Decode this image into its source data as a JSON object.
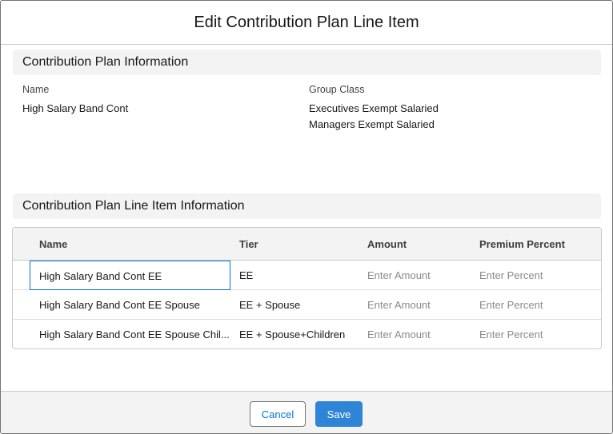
{
  "modal": {
    "title": "Edit Contribution Plan Line Item"
  },
  "plan_info": {
    "section_title": "Contribution Plan Information",
    "name_label": "Name",
    "name_value": "High Salary Band Cont",
    "group_class_label": "Group Class",
    "group_classes": [
      "Executives Exempt Salaried",
      "Managers Exempt Salaried"
    ]
  },
  "line_items": {
    "section_title": "Contribution Plan Line Item Information",
    "columns": [
      "Name",
      "Tier",
      "Amount",
      "Premium Percent"
    ],
    "rows": [
      {
        "name": "High Salary Band Cont EE",
        "tier": "EE",
        "amount_placeholder": "Enter Amount",
        "percent_placeholder": "Enter Percent"
      },
      {
        "name": "High Salary Band Cont EE Spouse",
        "tier": "EE + Spouse",
        "amount_placeholder": "Enter Amount",
        "percent_placeholder": "Enter Percent"
      },
      {
        "name": "High Salary Band Cont EE Spouse Chil...",
        "tier": "EE + Spouse+Children",
        "amount_placeholder": "Enter Amount",
        "percent_placeholder": "Enter Percent"
      }
    ]
  },
  "footer": {
    "cancel_label": "Cancel",
    "save_label": "Save"
  },
  "colors": {
    "brand": "#0176d3",
    "save_bg": "#2e84d6",
    "section_bg": "#f3f3f3"
  }
}
